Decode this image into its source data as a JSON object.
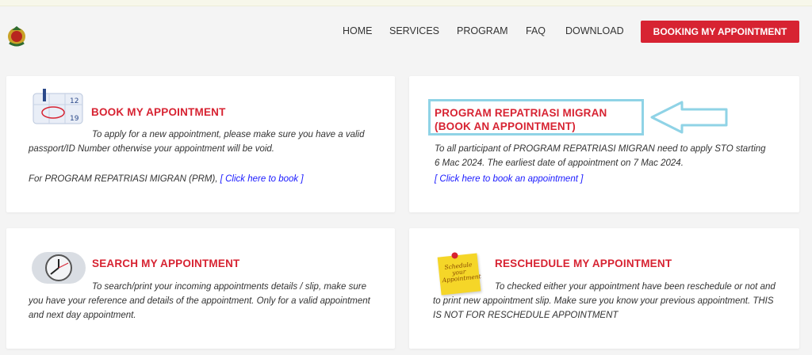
{
  "header": {
    "nav": [
      "HOME",
      "SERVICES",
      "PROGRAM",
      "FAQ",
      "DOWNLOAD"
    ],
    "cta": "BOOKING MY APPOINTMENT"
  },
  "cards": {
    "book": {
      "title": "BOOK MY APPOINTMENT",
      "text1": "To apply for a new appointment, please make sure you have a valid passport/ID Number otherwise your appointment will be void.",
      "text2_prefix": "For PROGRAM REPATRIASI MIGRAN (PRM),",
      "link": "[ Click here to book ]"
    },
    "prm": {
      "title_line1": "PROGRAM REPATRIASI MIGRAN",
      "title_line2": "(BOOK AN APPOINTMENT)",
      "text": "To all participant of PROGRAM REPATRIASI MIGRAN need to apply STO starting 6 Mac 2024. The earliest date of appointment on 7 Mac 2024.",
      "link": "[ Click here to book an appointment ]"
    },
    "search": {
      "title": "SEARCH MY APPOINTMENT",
      "text": "To search/print your incoming appointments details / slip, make sure you have your reference and details of the appointment. Only for a valid appointment and next day appointment."
    },
    "reschedule": {
      "title": "RESCHEDULE MY APPOINTMENT",
      "text": "To checked either your appointment have been reschedule or not and to print new appointment slip. Make sure you know your previous appointment. THIS IS NOT FOR RESCHEDULE APPOINTMENT",
      "note_text": "Schedule your Appointment"
    }
  },
  "colors": {
    "accent": "#d72332",
    "link": "#1a1aff",
    "highlight": "#8fd3e6"
  }
}
